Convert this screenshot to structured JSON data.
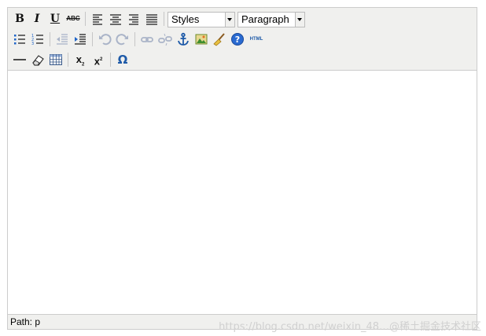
{
  "toolbar": {
    "row1": [
      "bold",
      "italic",
      "underline",
      "strikethrough",
      "align-left",
      "align-center",
      "align-right",
      "align-justify"
    ],
    "styles_select": {
      "value": "Styles"
    },
    "format_select": {
      "value": "Paragraph"
    },
    "row2": [
      "bullet-list",
      "numbered-list",
      "outdent",
      "indent",
      "undo",
      "redo",
      "link",
      "unlink",
      "anchor",
      "image",
      "cleanup",
      "help",
      "html-source"
    ],
    "row3": [
      "horizontal-rule",
      "remove-format",
      "table",
      "subscript",
      "superscript",
      "special-character"
    ],
    "labels": {
      "bold": "B",
      "italic": "I",
      "underline": "U",
      "strike": "ABC",
      "html": "HTML",
      "subscript": "x",
      "superscript": "x",
      "omega": "Ω"
    }
  },
  "statusbar": {
    "path": "Path: p"
  },
  "watermark": {
    "text": "https://blog.csdn.net/weixin_48…@稀土掘金技术社区"
  },
  "colors": {
    "toolbar_bg": "#f0f0ee",
    "border": "#cccccc",
    "link_blue": "#1e64c8",
    "disabled": "#aab4c8"
  }
}
